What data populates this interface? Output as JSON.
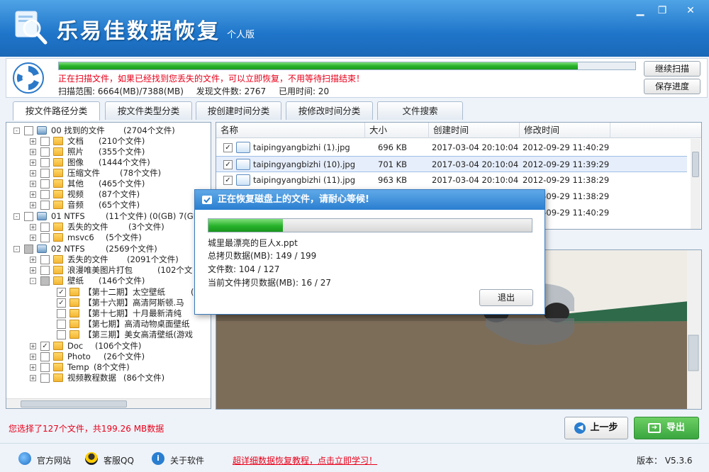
{
  "window": {
    "title": "乐易佳数据恢复",
    "edition": "个人版",
    "minimize_glyph": "▁",
    "restore_glyph": "❐",
    "close_glyph": "✕"
  },
  "scan": {
    "progress": 0.9,
    "message": "正在扫描文件，如果已经找到您丢失的文件，可以立即恢复，不用等待扫描结束！",
    "range_label": "扫描范围: 6664(MB)/7388(MB)",
    "found_label": "发现文件数: 2767",
    "time_label": "已用时间: 20",
    "continue_button": "继续扫描",
    "save_button": "保存进度"
  },
  "tabs": [
    "按文件路径分类",
    "按文件类型分类",
    "按创建时间分类",
    "按修改时间分类",
    "文件搜索"
  ],
  "tree": [
    {
      "id": "00",
      "label": "00  找到的文件",
      "count": "(2704个文件)"
    },
    {
      "label": "文档",
      "count": "(210个文件)"
    },
    {
      "label": "照片",
      "count": "(355个文件)"
    },
    {
      "label": "图像",
      "count": "(1444个文件)"
    },
    {
      "label": "压缩文件",
      "count": "(78个文件)"
    },
    {
      "label": "其他",
      "count": "(465个文件)"
    },
    {
      "label": "视频",
      "count": "(87个文件)"
    },
    {
      "label": "音频",
      "count": "(65个文件)"
    },
    {
      "label": "01  NTFS",
      "count": "(11个文件) (0(GB) 7(GB)"
    },
    {
      "label": "丢失的文件",
      "count": "(3个文件)"
    },
    {
      "label": "msvc6",
      "count": "(5个文件)"
    },
    {
      "label": "02  NTFS",
      "count": "(2569个文件)"
    },
    {
      "label": "丢失的文件",
      "count": "(2091个文件)"
    },
    {
      "label": "浪漫唯美图片打包",
      "count": "(102个文"
    },
    {
      "label": "壁纸",
      "count": "(146个文件)"
    },
    {
      "label": "【第十二期】太空壁纸",
      "count": "("
    },
    {
      "label": "【第十六期】高清阿斯顿.马",
      "count": ""
    },
    {
      "label": "【第十七期】十月最新清纯",
      "count": ""
    },
    {
      "label": "【第七期】高清动物桌面壁纸",
      "count": ""
    },
    {
      "label": "【第三期】美女高清壁纸(游戏",
      "count": ""
    },
    {
      "label": "Doc",
      "count": "(106个文件)"
    },
    {
      "label": "Photo",
      "count": "(26个文件)"
    },
    {
      "label": "Temp",
      "count": "(8个文件)"
    },
    {
      "label": "视频教程数据",
      "count": "(86个文件)"
    }
  ],
  "files": {
    "headers": {
      "name": "名称",
      "size": "大小",
      "created": "创建时间",
      "modified": "修改时间"
    },
    "rows": [
      {
        "name": "taipingyangbizhi (1).jpg",
        "size": "696 KB",
        "created": "2017-03-04  20:10:04",
        "modified": "2012-09-29  11:40:29"
      },
      {
        "name": "taipingyangbizhi (10).jpg",
        "size": "701 KB",
        "created": "2017-03-04  20:10:04",
        "modified": "2012-09-29  11:39:29"
      },
      {
        "name": "taipingyangbizhi (11).jpg",
        "size": "963 KB",
        "created": "2017-03-04  20:10:04",
        "modified": "2012-09-29  11:38:29"
      },
      {
        "name": "",
        "size": "",
        "created": "",
        "modified": "2012-09-29  11:38:29"
      },
      {
        "name": "",
        "size": "",
        "created": "",
        "modified": "2012-09-29  11:40:29"
      }
    ]
  },
  "dialog": {
    "title": "正在恢复磁盘上的文件，请耐心等候!",
    "progress": 0.23,
    "current_file": "城里最漂亮的巨人x.ppt",
    "total_copy": "总拷贝数据(MB):   149 / 199",
    "file_count": "文件数:   104 / 127",
    "current_copy": "当前文件拷贝数据(MB):   16 / 27",
    "exit_button": "退出"
  },
  "footer": {
    "selection": "您选择了127个文件，共199.26 MB数据",
    "prev_button": "上一步",
    "export_button": "导出",
    "website": "官方网站",
    "qq": "客服QQ",
    "about": "关于软件",
    "tutorial": "超详细数据恢复教程，点击立即学习！",
    "version": "版本：  V5.3.6"
  },
  "colors": {
    "accent": "#1f75c9",
    "progress": "#29b32a",
    "alert": "#e8001a",
    "export": "#3aa63f"
  }
}
